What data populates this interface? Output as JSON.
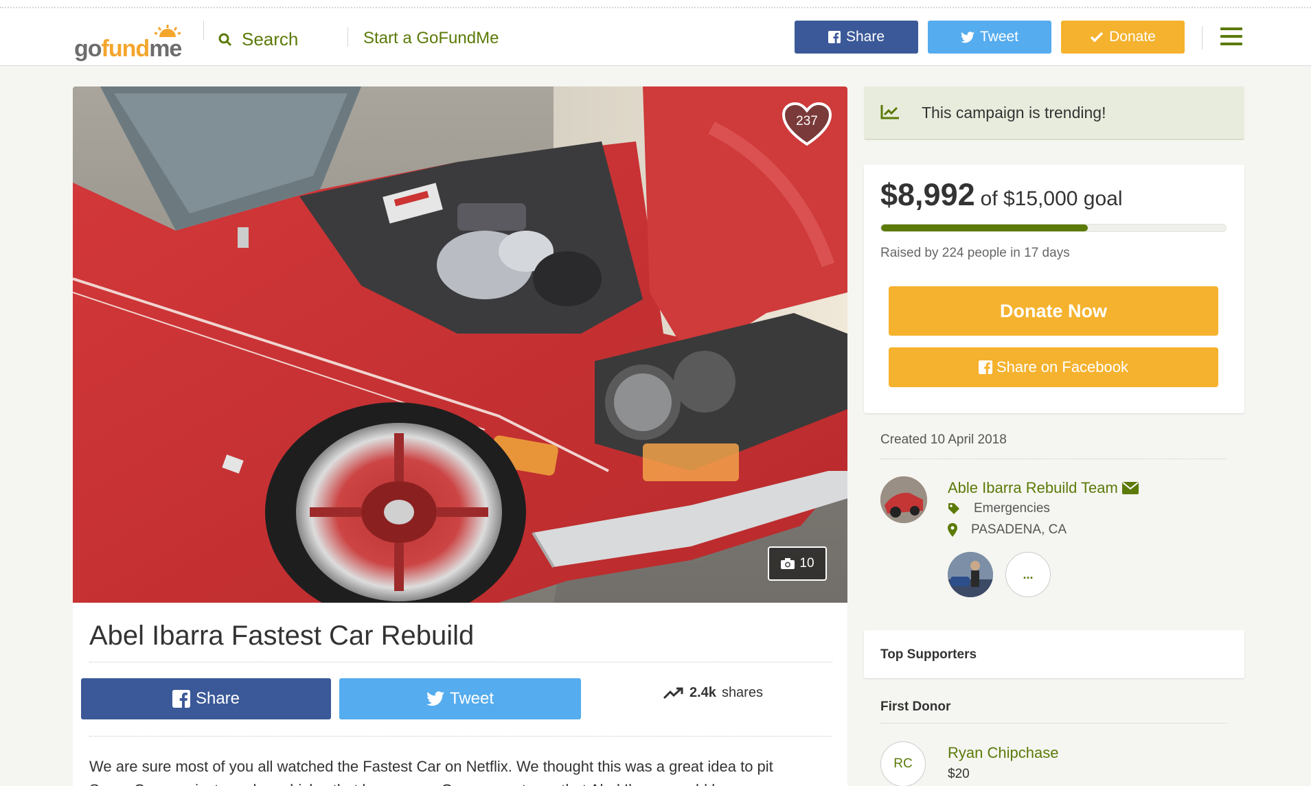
{
  "header": {
    "logo_text_a": "go",
    "logo_text_b": "fund",
    "logo_text_c": "me",
    "search_label": "Search",
    "start_label": "Start a GoFundMe",
    "share_label": "Share",
    "tweet_label": "Tweet",
    "donate_label": "Donate"
  },
  "photo": {
    "hearts": "237",
    "photo_count": "10"
  },
  "campaign": {
    "title": "Abel Ibarra Fastest Car Rebuild",
    "share_label": "Share",
    "tweet_label": "Tweet",
    "shares_count": "2.4k",
    "shares_label": "shares",
    "story_line1": "We are sure most of you all watched the Fastest Car on Netflix. We thought this was a great idea to pit",
    "story_line2": "Super Cars against regular vehicles that have gone. Our one part was that Abel Ibarra would be"
  },
  "sidebar": {
    "trending": "This campaign is trending!",
    "raised_amount": "$8,992",
    "goal_text": "of $15,000 goal",
    "progress_fraction": 0.5995,
    "byline": "Raised by 224 people in 17 days",
    "donate_now": "Donate Now",
    "share_facebook": "Share on Facebook",
    "created": "Created 10 April 2018",
    "organizer": "Able Ibarra Rebuild Team",
    "category": "Emergencies",
    "location": "PASADENA, CA",
    "more": "...",
    "top_supporters": "Top Supporters",
    "first_donor_label": "First Donor",
    "first_donor_initials": "RC",
    "first_donor_name": "Ryan Chipchase",
    "first_donor_amount": "$20"
  },
  "colors": {
    "brand_green": "#5b7a08",
    "facebook": "#3b5998",
    "twitter": "#55acee",
    "donate_orange": "#f5b22e"
  }
}
